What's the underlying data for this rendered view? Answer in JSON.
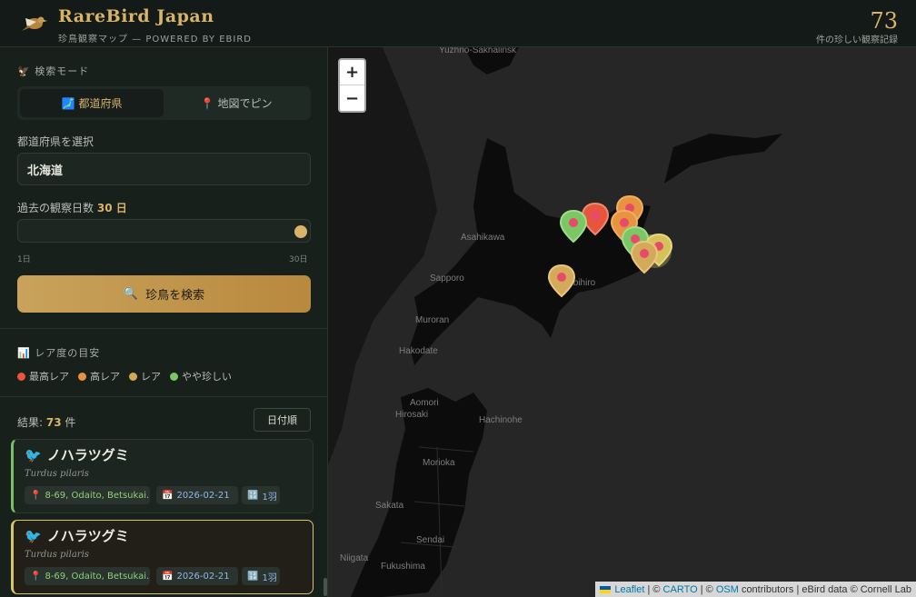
{
  "header": {
    "title": "RareBird Japan",
    "subtitle": "珍鳥観察マップ — POWERED BY EBIRD",
    "count": "73",
    "count_label": "件の珍しい観察記録"
  },
  "sidebar": {
    "search_mode_label": "検索モード",
    "mode_prefecture": "都道府県",
    "mode_pin": "地図でピン",
    "prefecture_label": "都道府県を選択",
    "prefecture_value": "北海道",
    "days_label_prefix": "過去の観察日数",
    "days_value": "30 日",
    "days_fraction": 1.0,
    "days_min": "1日",
    "days_max": "30日",
    "search_button": "珍鳥を検索",
    "rarity_label": "レア度の目安",
    "rarity_levels": [
      {
        "label": "最高レア",
        "color": "#e8553f"
      },
      {
        "label": "高レア",
        "color": "#e8933f"
      },
      {
        "label": "レア",
        "color": "#d4a95a"
      },
      {
        "label": "やや珍しい",
        "color": "#7bc665"
      }
    ],
    "results_prefix": "結果:",
    "results_count": "73",
    "results_suffix": "件",
    "sort_label": "日付順",
    "cards": [
      {
        "name": "ノハラツグミ",
        "sci": "Turdus pilaris",
        "location": "8-69, Odaito, Betsukai...",
        "date": "2026-02-21",
        "count": "1羽"
      },
      {
        "name": "ノハラツグミ",
        "sci": "Turdus pilaris",
        "location": "8-69, Odaito, Betsukai...",
        "date": "2026-02-21",
        "count": "1羽"
      }
    ]
  },
  "map": {
    "zoom_in": "+",
    "zoom_out": "−",
    "places": [
      "Yuzhno-Sakhalinsk",
      "Asahikawa",
      "Sapporo",
      "Obihiro",
      "Muroran",
      "Hakodate",
      "Aomori",
      "Hirosaki",
      "Hachinohe",
      "Morioka",
      "Sakata",
      "Sendai",
      "Niigata",
      "Fukushima"
    ],
    "attribution": {
      "leaflet": "Leaflet",
      "sep1": "| ©",
      "carto": "CARTO",
      "sep2": "| ©",
      "osm": "OSM",
      "rest": "contributors | eBird data © Cornell Lab"
    }
  },
  "colors": {
    "accent": "#d7b46a",
    "bg": "#18201c"
  }
}
